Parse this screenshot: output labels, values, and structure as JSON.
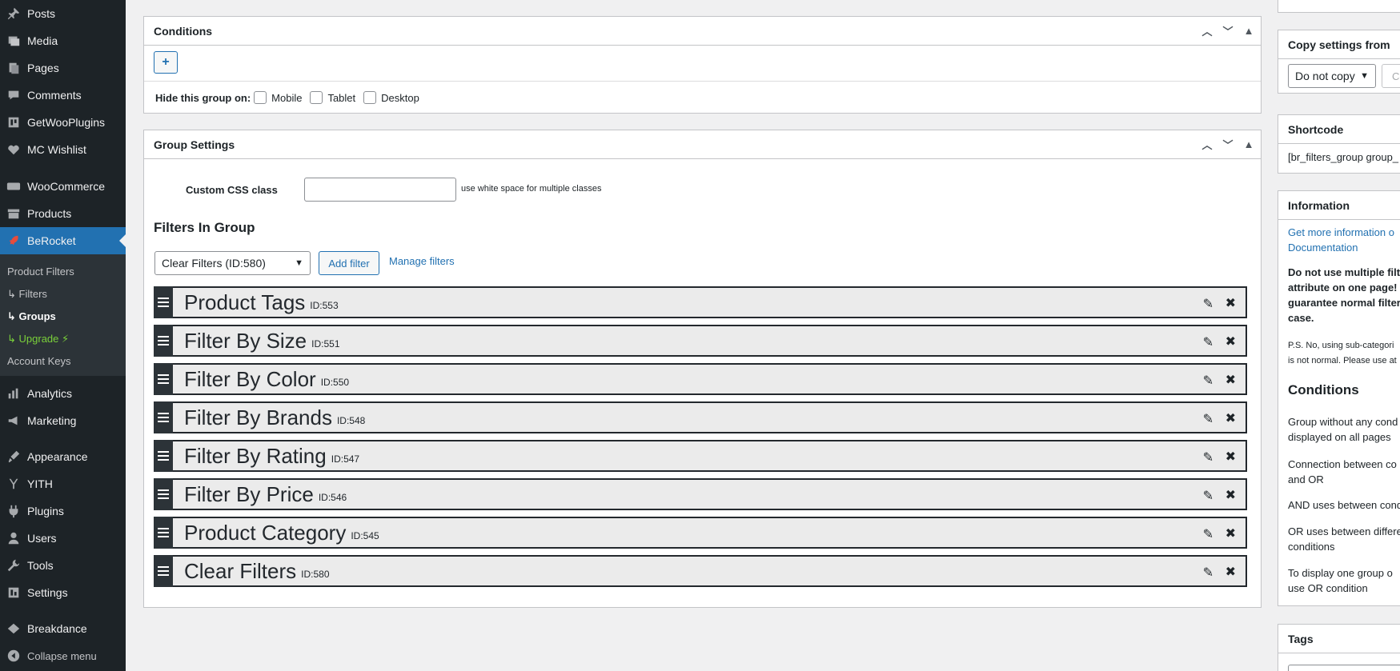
{
  "sidebar": {
    "items_top": [
      {
        "label": "Posts",
        "icon": "pin-icon"
      },
      {
        "label": "Media",
        "icon": "media-icon"
      },
      {
        "label": "Pages",
        "icon": "pages-icon"
      },
      {
        "label": "Comments",
        "icon": "comments-icon"
      },
      {
        "label": "GetWooPlugins",
        "icon": "plugin-box-icon"
      },
      {
        "label": "MC Wishlist",
        "icon": "heart-icon"
      },
      {
        "label": "WooCommerce",
        "icon": "woo-icon"
      },
      {
        "label": "Products",
        "icon": "archive-icon"
      },
      {
        "label": "BeRocket",
        "icon": "rocket-icon"
      }
    ],
    "submenu": {
      "product_filters": "Product Filters",
      "filters": "Filters",
      "groups": "Groups",
      "upgrade": "Upgrade ⚡",
      "account_keys": "Account Keys"
    },
    "items_bottom": [
      {
        "label": "Analytics",
        "icon": "chart-icon"
      },
      {
        "label": "Marketing",
        "icon": "megaphone-icon"
      },
      {
        "label": "Appearance",
        "icon": "brush-icon"
      },
      {
        "label": "YITH",
        "icon": "yith-icon"
      },
      {
        "label": "Plugins",
        "icon": "plugins-icon"
      },
      {
        "label": "Users",
        "icon": "users-icon"
      },
      {
        "label": "Tools",
        "icon": "wrench-icon"
      },
      {
        "label": "Settings",
        "icon": "settings-icon"
      },
      {
        "label": "Breakdance",
        "icon": "breakdance-icon"
      },
      {
        "label": "Collapse menu",
        "icon": "collapse-icon"
      }
    ]
  },
  "conditions": {
    "title": "Conditions",
    "add_symbol": "+",
    "hide_label": "Hide this group on:",
    "devices": [
      "Mobile",
      "Tablet",
      "Desktop"
    ]
  },
  "group_settings": {
    "title": "Group Settings",
    "css_label": "Custom CSS class",
    "css_value": "",
    "css_hint": "use white space for multiple classes",
    "filters_heading": "Filters In Group",
    "select_value": "Clear Filters (ID:580)",
    "add_filter": "Add filter",
    "manage_filters": "Manage filters",
    "filters": [
      {
        "name": "Product Tags",
        "id": "ID:553"
      },
      {
        "name": "Filter By Size",
        "id": "ID:551"
      },
      {
        "name": "Filter By Color",
        "id": "ID:550"
      },
      {
        "name": "Filter By Brands",
        "id": "ID:548"
      },
      {
        "name": "Filter By Rating",
        "id": "ID:547"
      },
      {
        "name": "Filter By Price",
        "id": "ID:546"
      },
      {
        "name": "Product Category",
        "id": "ID:545"
      },
      {
        "name": "Clear Filters",
        "id": "ID:580"
      }
    ]
  },
  "right": {
    "copy_title": "Copy settings from",
    "copy_select": "Do not copy",
    "copy_button": "Co",
    "shortcode_title": "Shortcode",
    "shortcode_value": "[br_filters_group group_",
    "info_title": "Information",
    "info_link_1": "Get more information o",
    "info_link_2": "Documentation",
    "warn_1": "Do not use multiple filt",
    "warn_2": "attribute on one page!",
    "warn_3": "guarantee normal filter",
    "warn_4": "case.",
    "ps_1": "P.S. No, using sub-categori",
    "ps_2": "is not normal. Please use at",
    "cond_heading": "Conditions",
    "cond_1a": "Group without any cond",
    "cond_1b": "displayed on all pages",
    "cond_2a": "Connection between co",
    "cond_2b": "and OR",
    "cond_3": "AND uses between cond",
    "cond_4a": "OR uses between differe",
    "cond_4b": "conditions",
    "cond_5a": "To display one group o",
    "cond_5b": "use OR condition",
    "tags_title": "Tags"
  }
}
